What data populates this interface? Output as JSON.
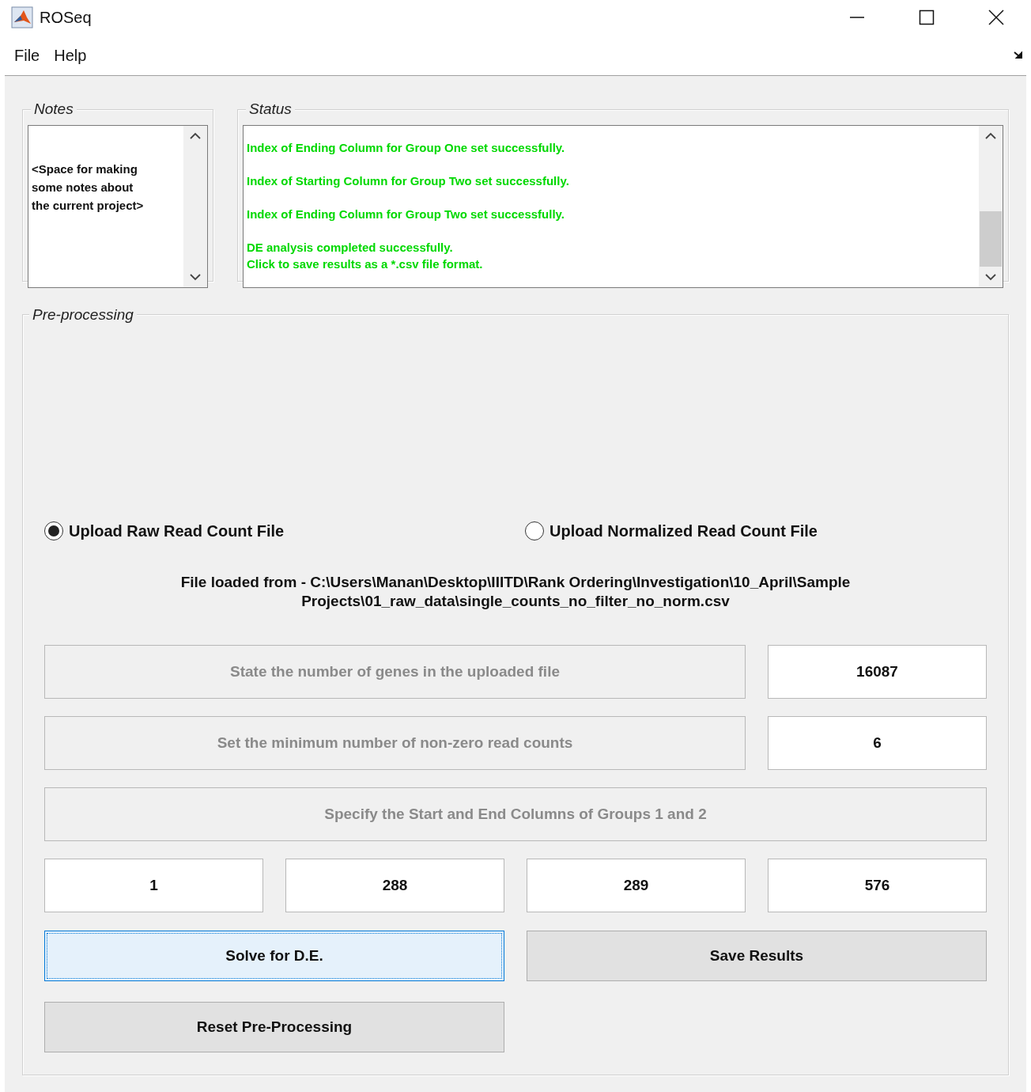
{
  "window": {
    "title": "ROSeq"
  },
  "menu": [
    {
      "label": "File"
    },
    {
      "label": "Help"
    }
  ],
  "notes": {
    "title": "Notes",
    "text": "<Space for making\nsome notes about\nthe current project>"
  },
  "status": {
    "title": "Status",
    "messages": [
      [
        "Index of Ending Column for Group One set successfully."
      ],
      [
        "Index of Starting Column for Group Two set successfully."
      ],
      [
        "Index of Ending Column for Group Two set successfully."
      ],
      [
        "DE analysis completed successfully.",
        "Click to save results as a *.csv file format."
      ]
    ]
  },
  "preprocessing": {
    "title": "Pre-processing",
    "radios": [
      {
        "label": "Upload Raw Read Count File",
        "selected": true
      },
      {
        "label": "Upload Normalized Read Count File",
        "selected": false
      }
    ],
    "file_info": [
      "File loaded from - C:\\Users\\Manan\\Desktop\\IIITD\\Rank Ordering\\Investigation\\10_April\\Sample",
      "Projects\\01_raw_data\\single_counts_no_filter_no_norm.csv"
    ],
    "rows": [
      {
        "label": "State the number of genes in the uploaded file",
        "value": "16087"
      },
      {
        "label": "Set the minimum number of non-zero read counts",
        "value": "6"
      },
      {
        "label": "Specify the Start and End Columns of Groups 1 and 2"
      }
    ],
    "columns": [
      "1",
      "288",
      "289",
      "576"
    ],
    "buttons": [
      {
        "label": "Solve for D.E.",
        "focused": true
      },
      {
        "label": "Save Results",
        "focused": false
      },
      {
        "label": "Reset Pre-Processing",
        "focused": false
      }
    ]
  }
}
